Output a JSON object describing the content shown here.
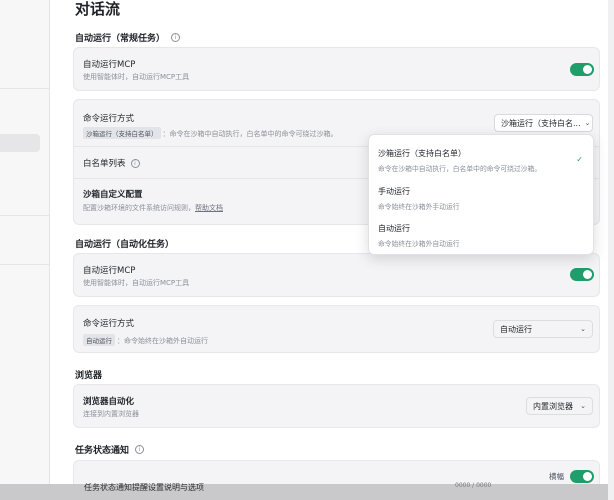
{
  "page_title": "对话流",
  "sections": {
    "regular": {
      "title": "自动运行（常规任务）"
    },
    "auto": {
      "title": "自动运行（自动化任务）"
    },
    "browser": {
      "title": "浏览器"
    },
    "notify": {
      "title": "任务状态通知"
    }
  },
  "regular_card": {
    "mcp": {
      "title": "自动运行MCP",
      "desc": "使用智能体时，自动运行MCP工具",
      "enabled": true
    },
    "command": {
      "title": "命令运行方式",
      "tag": "沙箱运行（支持白名单）",
      "desc": "：命令在沙箱中自动执行，白名单中的命令可绕过沙箱。",
      "select_value": "沙箱运行（支持白名..."
    },
    "whitelist": {
      "title": "白名单列表"
    },
    "sandbox_config": {
      "title": "沙箱自定义配置",
      "desc": "配置沙箱环境的文件系统访问规则，",
      "link": "帮助文档"
    }
  },
  "dropdown": {
    "options": [
      {
        "title": "沙箱运行（支持白名单）",
        "desc": "命令在沙箱中自动执行，白名单中的命令可绕过沙箱。",
        "selected": true
      },
      {
        "title": "手动运行",
        "desc": "命令始终在沙箱外手动运行",
        "selected": false
      },
      {
        "title": "自动运行",
        "desc": "命令始终在沙箱外自动运行",
        "selected": false
      }
    ],
    "check_icon": "✓"
  },
  "auto_card_mcp": {
    "title": "自动运行MCP",
    "desc": "使用智能体时，自动运行MCP工具",
    "enabled": true
  },
  "auto_card_command": {
    "title": "命令运行方式",
    "tag": "自动运行",
    "desc": "：命令始终在沙箱外自动运行",
    "select_value": "自动运行"
  },
  "browser_card": {
    "title": "浏览器自动化",
    "desc": "连接到内置浏览器",
    "select_value": "内置浏览器"
  },
  "notify_card": {
    "edit_label": "横幅",
    "enabled": true,
    "overlay_text": "任务状态通知提醒设置说明与选项",
    "mini_text": "0000 / 0000"
  },
  "colors": {
    "accent": "#1f9d6b",
    "card_bg": "#f4f4f6"
  }
}
